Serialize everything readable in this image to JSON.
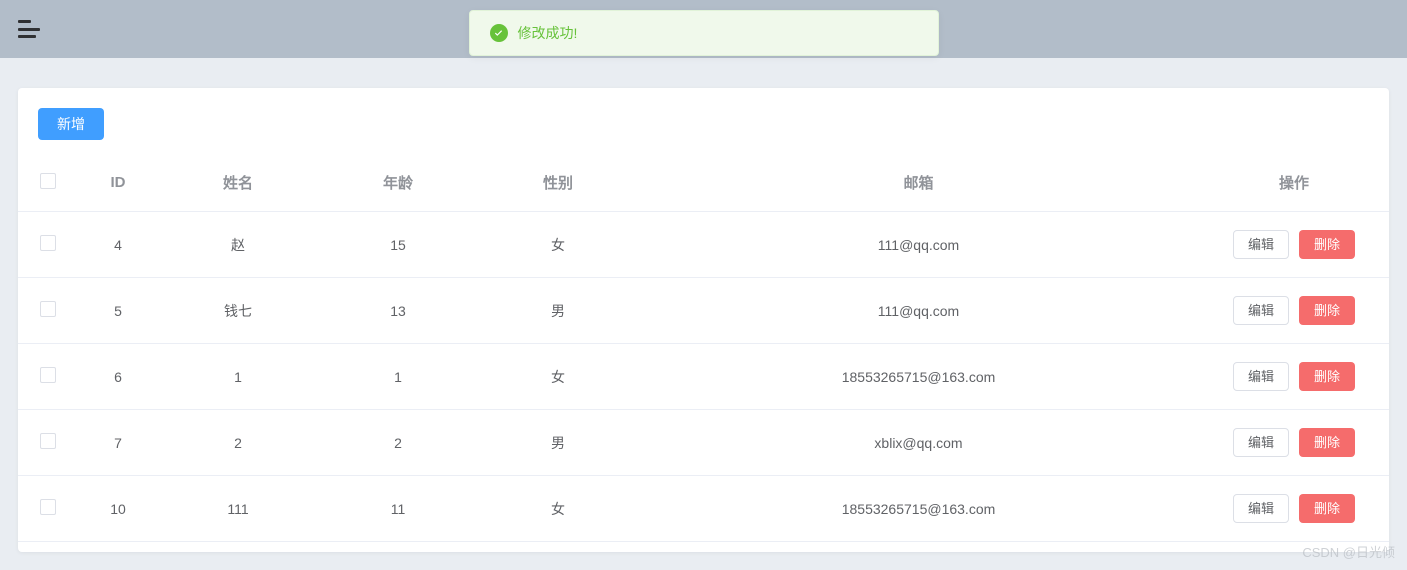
{
  "toast": {
    "message": "修改成功!"
  },
  "toolbar": {
    "add_label": "新增"
  },
  "columns": {
    "id": "ID",
    "name": "姓名",
    "age": "年龄",
    "gender": "性别",
    "email": "邮箱",
    "ops": "操作"
  },
  "actions": {
    "edit": "编辑",
    "delete": "删除"
  },
  "rows": [
    {
      "id": "4",
      "name": "赵",
      "age": "15",
      "gender": "女",
      "email": "111@qq.com"
    },
    {
      "id": "5",
      "name": "钱七",
      "age": "13",
      "gender": "男",
      "email": "111@qq.com"
    },
    {
      "id": "6",
      "name": "1",
      "age": "1",
      "gender": "女",
      "email": "18553265715@163.com"
    },
    {
      "id": "7",
      "name": "2",
      "age": "2",
      "gender": "男",
      "email": "xblix@qq.com"
    },
    {
      "id": "10",
      "name": "111",
      "age": "11",
      "gender": "女",
      "email": "18553265715@163.com"
    }
  ],
  "watermark": "CSDN @日光倾"
}
